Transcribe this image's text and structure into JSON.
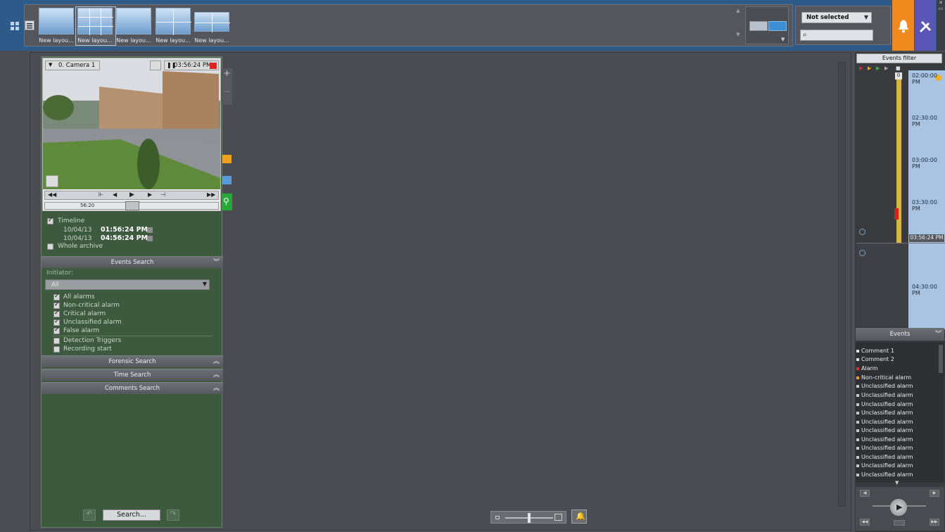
{
  "topbar": {
    "layouts": [
      {
        "label": "New layou..."
      },
      {
        "label": "New layou..."
      },
      {
        "label": "New layou..."
      },
      {
        "label": "New layou..."
      },
      {
        "label": "New layou..."
      }
    ],
    "filter_select": "Not selected",
    "search_placeholder": ""
  },
  "camera": {
    "title": "0. Camera 1",
    "time": "03:56:24 PM",
    "scrub_label": "56:20"
  },
  "timeline": {
    "timeline_label": "Timeline",
    "start_date": "10/04/13",
    "start_time": "01:56:24 PM",
    "end_date": "10/04/13",
    "end_time": "04:56:24 PM",
    "whole_archive": "Whole archive"
  },
  "events_search": {
    "header": "Events Search",
    "initiator_label": "Initiator:",
    "initiator_value": "All",
    "options": [
      {
        "label": "All alarms",
        "checked": true
      },
      {
        "label": "Non-critical alarm",
        "checked": true
      },
      {
        "label": "Critical alarm",
        "checked": true
      },
      {
        "label": "Unclassified alarm",
        "checked": true
      },
      {
        "label": "False alarm",
        "checked": true
      },
      {
        "label": "Detection Triggers",
        "checked": false
      },
      {
        "label": "Recording start",
        "checked": false
      }
    ]
  },
  "sections": {
    "forensic": "Forensic Search",
    "time": "Time Search",
    "comments": "Comments Search"
  },
  "search_button": "Search...",
  "right": {
    "filter_header": "Events filter",
    "scale_value": "0",
    "ticks": [
      "02:00:00 PM",
      "02:30:00 PM",
      "03:00:00 PM",
      "03:30:00 PM",
      "04:30:00 PM"
    ],
    "current_time": "03:56:24 PM",
    "events_header": "Events",
    "events": [
      {
        "label": "Comment 1",
        "color": "#dfe3e8"
      },
      {
        "label": "Comment 2",
        "color": "#dfe3e8"
      },
      {
        "label": "Alarm",
        "color": "#e03030"
      },
      {
        "label": "Non-critical alarm",
        "color": "#f0a020"
      },
      {
        "label": "Unclassified alarm",
        "color": "#c8c8c8"
      },
      {
        "label": "Unclassified alarm",
        "color": "#c8c8c8"
      },
      {
        "label": "Unclassified alarm",
        "color": "#c8c8c8"
      },
      {
        "label": "Unclassified alarm",
        "color": "#c8c8c8"
      },
      {
        "label": "Unclassified alarm",
        "color": "#c8c8c8"
      },
      {
        "label": "Unclassified alarm",
        "color": "#c8c8c8"
      },
      {
        "label": "Unclassified alarm",
        "color": "#c8c8c8"
      },
      {
        "label": "Unclassified alarm",
        "color": "#c8c8c8"
      },
      {
        "label": "Unclassified alarm",
        "color": "#c8c8c8"
      },
      {
        "label": "Unclassified alarm",
        "color": "#c8c8c8"
      },
      {
        "label": "Unclassified alarm",
        "color": "#c8c8c8"
      }
    ]
  },
  "colors": {
    "accent_blue": "#2e5a8a",
    "panel_green": "#3d5a3e",
    "alert_orange": "#f08a1e",
    "tools_purple": "#5b55b8",
    "search_green": "#26a83a"
  }
}
